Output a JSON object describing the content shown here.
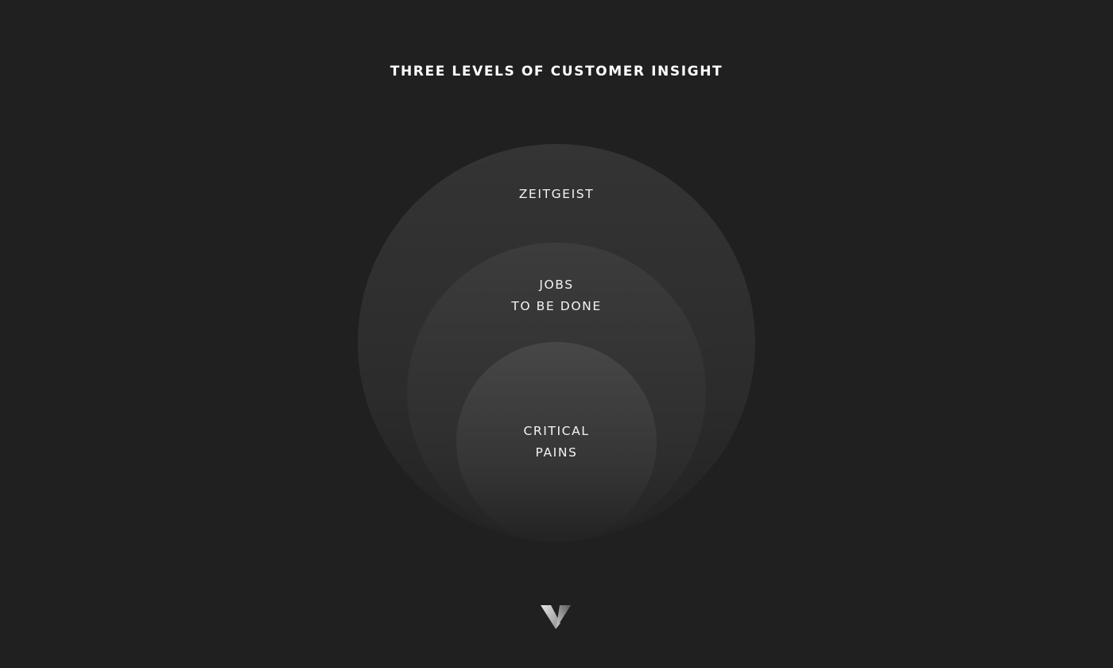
{
  "title": "THREE LEVELS OF CUSTOMER INSIGHT",
  "levels": [
    {
      "lines": [
        "ZEITGEIST"
      ]
    },
    {
      "lines": [
        "JOBS",
        "TO BE DONE"
      ]
    },
    {
      "lines": [
        "CRITICAL",
        "PAINS"
      ]
    }
  ],
  "logo": {
    "icon": "v-logo-icon"
  },
  "colors": {
    "background": "#202020",
    "text": "#f4f4f4",
    "outer_circle": "#343434",
    "middle_circle": "#3c3c3c",
    "inner_circle": "#474747"
  }
}
